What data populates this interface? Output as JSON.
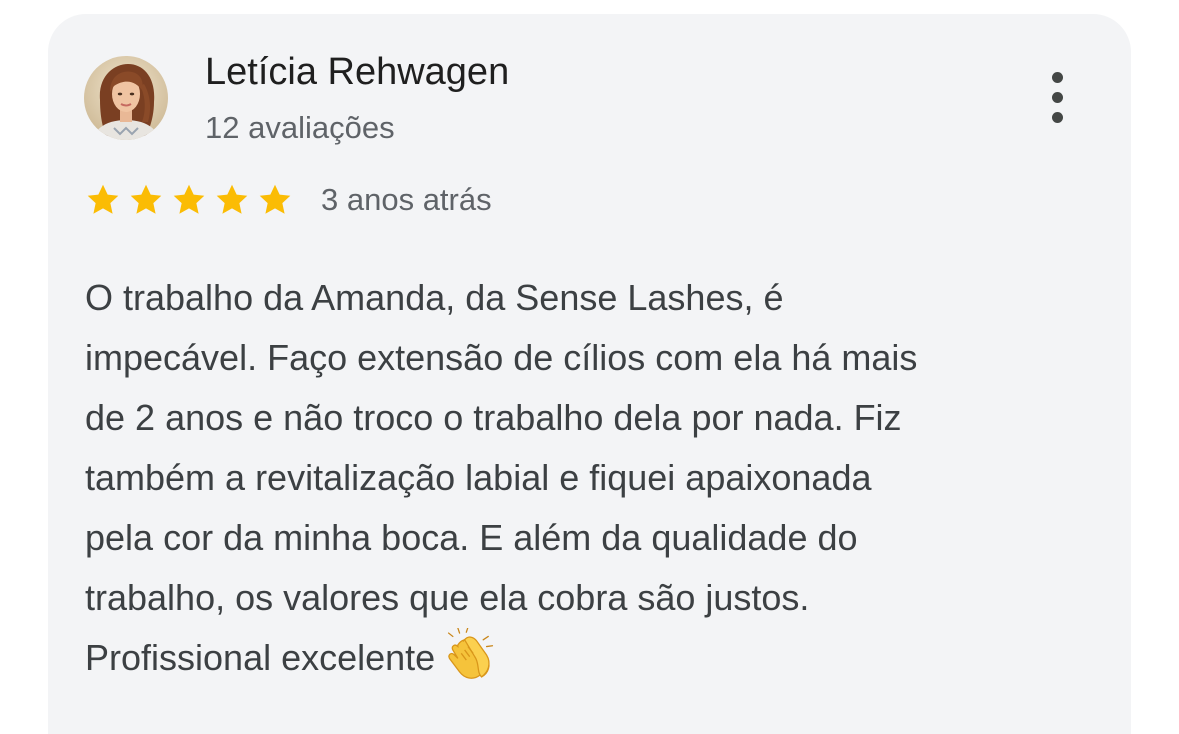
{
  "review": {
    "author_name": "Letícia Rehwagen",
    "review_count": "12 avaliações",
    "rating": 5,
    "rating_max": 5,
    "date": "3 anos atrás",
    "text_lines": [
      "O trabalho da Amanda, da Sense Lashes, é",
      "impecável. Faço extensão de cílios com ela há mais",
      "de 2 anos e não troco o trabalho dela por nada. Fiz",
      "também a revitalização labial e fiquei apaixonada",
      "pela cor da minha boca. E além da qualidade do",
      "trabalho, os valores que ela cobra são justos.",
      "Profissional excelente"
    ],
    "emoji": "clapping-hands-icon"
  },
  "icons": {
    "avatar": "avatar",
    "more": "more-vert-icon",
    "star": "star-icon"
  },
  "colors": {
    "card_background": "#f3f4f6",
    "star": "#fbbc04",
    "name_text": "#1f1f1f",
    "secondary_text": "#5f6368",
    "body_text": "#3c4043"
  }
}
